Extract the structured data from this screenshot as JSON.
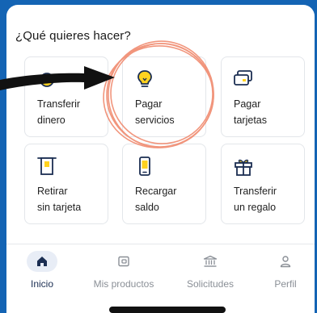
{
  "heading": "¿Qué quieres hacer?",
  "actions": [
    {
      "line1": "Transferir",
      "line2": "dinero",
      "icon": "money-transfer-icon"
    },
    {
      "line1": "Pagar",
      "line2": "servicios",
      "icon": "lightbulb-icon"
    },
    {
      "line1": "Pagar",
      "line2": "tarjetas",
      "icon": "credit-cards-icon"
    },
    {
      "line1": "Retirar",
      "line2": "sin tarjeta",
      "icon": "atm-icon"
    },
    {
      "line1": "Recargar",
      "line2": "saldo",
      "icon": "phone-icon"
    },
    {
      "line1": "Transferir",
      "line2": "un regalo",
      "icon": "gift-icon"
    }
  ],
  "nav": [
    {
      "label": "Inicio",
      "icon": "home-icon",
      "active": true
    },
    {
      "label": "Mis productos",
      "icon": "wallet-icon",
      "active": false
    },
    {
      "label": "Solicitudes",
      "icon": "bank-icon",
      "active": false
    },
    {
      "label": "Perfil",
      "icon": "user-icon",
      "active": false
    }
  ],
  "colors": {
    "background_frame": "#1464b4",
    "icon_stroke": "#1b2e52",
    "icon_accent": "#ffd21f",
    "annotation_circle": "#f08a6e",
    "annotation_arrow": "#111111"
  }
}
